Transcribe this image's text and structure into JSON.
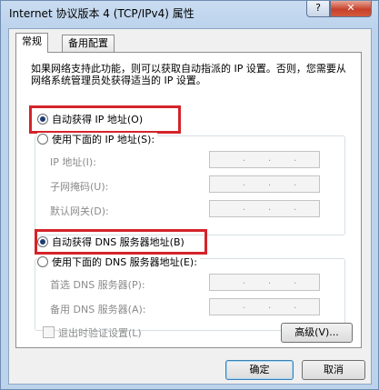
{
  "window": {
    "title": "Internet 协议版本 4 (TCP/IPv4) 属性",
    "help_label": "?",
    "close_label": "✕"
  },
  "tabs": [
    {
      "label": "常规",
      "active": true
    },
    {
      "label": "备用配置",
      "active": false
    }
  ],
  "description": "如果网络支持此功能，则可以获取自动指派的 IP 设置。否则，您需要从网络系统管理员处获得适当的 IP 设置。",
  "ip": {
    "auto_label": "自动获得 IP 地址(O)",
    "manual_label": "使用下面的 IP 地址(S):",
    "fields": [
      {
        "label": "IP 地址(I):",
        "value": ". . ."
      },
      {
        "label": "子网掩码(U):",
        "value": ". . ."
      },
      {
        "label": "默认网关(D):",
        "value": ". . ."
      }
    ]
  },
  "dns": {
    "auto_label": "自动获得 DNS 服务器地址(B)",
    "manual_label": "使用下面的 DNS 服务器地址(E):",
    "fields": [
      {
        "label": "首选 DNS 服务器(P):",
        "value": ". . ."
      },
      {
        "label": "备用 DNS 服务器(A):",
        "value": ". . ."
      }
    ]
  },
  "validate_label": "退出时验证设置(L)",
  "advanced_label": "高级(V)...",
  "ok_label": "确定",
  "cancel_label": "取消",
  "colors": {
    "highlight": "#d5232a",
    "title_bar": "#bcd3ec",
    "close_button": "#c7412a"
  }
}
